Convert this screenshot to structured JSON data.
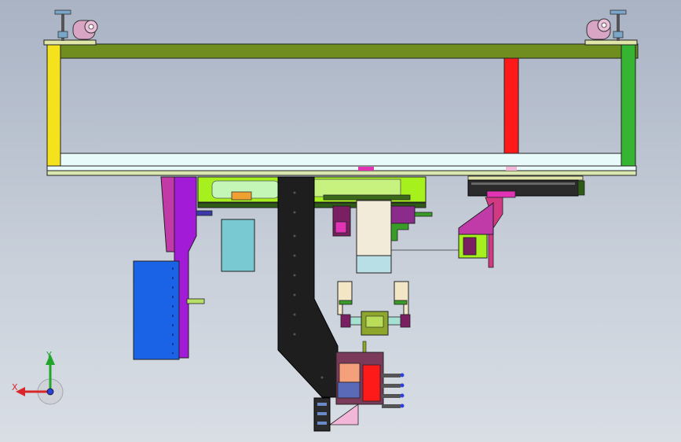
{
  "view": {
    "type": "cad-orthographic-view",
    "background_top": "#a9b3c4",
    "background_bottom": "#d9dee5"
  },
  "triad": {
    "x_label": "X",
    "y_label": "Y",
    "x_color": "#d9262b",
    "y_color": "#21a62b",
    "z_color": "#2b3fd9"
  },
  "colors": {
    "frame_top_beam": "#6f8e1f",
    "frame_left_post": "#f4e21c",
    "frame_right_post": "#36b532",
    "red_post": "#ff1a1a",
    "bottom_rail": "#e9fafa",
    "support_plate": "#dfe6a8",
    "caster": "#d8a5c5",
    "purple_column": "#a21bd6",
    "blue_box": "#1a63e6",
    "lime_plate": "#a6f01e",
    "black_arm": "#1e1e1e",
    "teal_box": "#79c9d3",
    "cylinder": "#2b2b2b",
    "magenta": "#e034b4",
    "cream_block": "#f2ebd9",
    "olive": "#8ea62c",
    "salmon": "#f4a07a",
    "pink_triangle": "#f1b6d8"
  }
}
